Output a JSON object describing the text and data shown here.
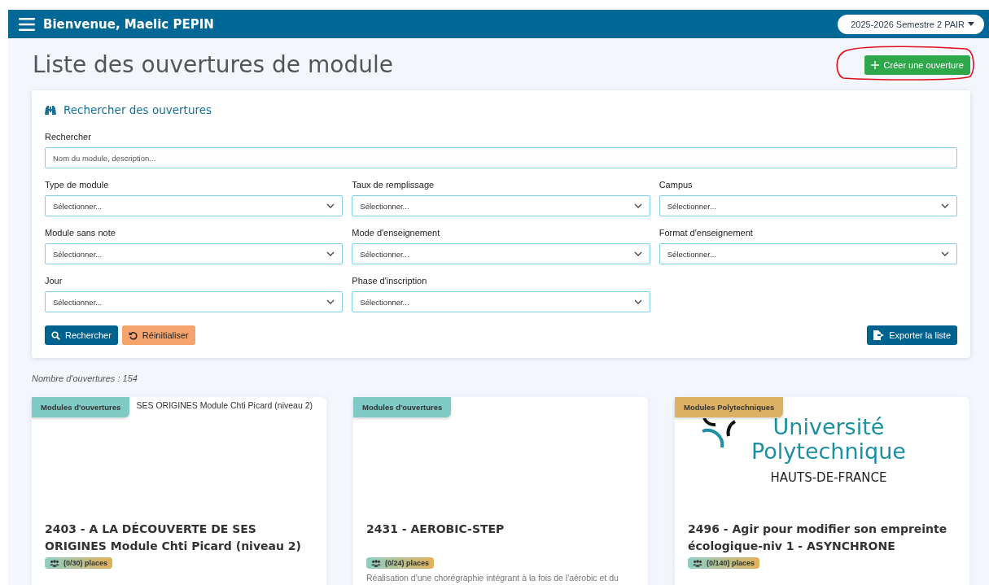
{
  "navbar": {
    "title": "Bienvenue, Maelic PEPIN",
    "semester": "2025-2026 Semestre 2 PAIR"
  },
  "page_title": "Liste des ouvertures de module",
  "create_button": {
    "label": "Créer une ouverture",
    "circled": true
  },
  "search_panel": {
    "title": "Rechercher des ouvertures",
    "fields": [
      {
        "kind": "text",
        "label": "Rechercher",
        "placeholder": "Nom du module, description..."
      },
      {
        "kind": "select",
        "label": "Type de module",
        "placeholder": "Sélectionner..."
      },
      {
        "kind": "select",
        "label": "Taux de remplissage",
        "placeholder": "Sélectionner..."
      },
      {
        "kind": "select",
        "label": "Campus",
        "placeholder": "Sélectionner..."
      },
      {
        "kind": "select",
        "label": "Module sans note",
        "placeholder": "Sélectionner..."
      },
      {
        "kind": "select",
        "label": "Mode d'enseignement",
        "placeholder": "Sélectionner..."
      },
      {
        "kind": "select",
        "label": "Format d'enseignement",
        "placeholder": "Sélectionner..."
      },
      {
        "kind": "select",
        "label": "Jour",
        "placeholder": "Sélectionner..."
      },
      {
        "kind": "select",
        "label": "Phase d'inscription",
        "placeholder": "Sélectionner..."
      }
    ],
    "search_button": "Rechercher",
    "reset_button": "Réinitialiser",
    "export_button": "Exporter la liste"
  },
  "count": "Nombre d'ouvertures : 154",
  "cards": [
    {
      "category": "Modules d'ouvertures",
      "color": "#7ecac4",
      "image": {
        "kind": "alt_text",
        "text": "SES ORIGINES Module Chti Picard (niveau 2)"
      },
      "title": "2403 - A LA DÉCOUVERTE DE SES ORIGINES Module Chti Picard (niveau 2)",
      "places": "(0/30) places"
    },
    {
      "category": "Modules d'ouvertures",
      "color": "#7ecac4",
      "image": {
        "kind": "blank"
      },
      "title": "2431 - AEROBIC-STEP",
      "places": "(0/24) places",
      "description": "Réalisation d'une chorégraphie intégrant à la fois de l'aérobic et du"
    },
    {
      "category": "Modules Polytechniques",
      "color": "#ddb163",
      "image": {
        "kind": "logo",
        "lines": [
          "Université",
          "Polytechnique",
          "HAUTS-DE-FRANCE"
        ]
      },
      "title": "2496 - Agir pour modifier son empreinte écologique-niv 1 - ASYNCHRONE",
      "places": "(0/140) places"
    }
  ]
}
